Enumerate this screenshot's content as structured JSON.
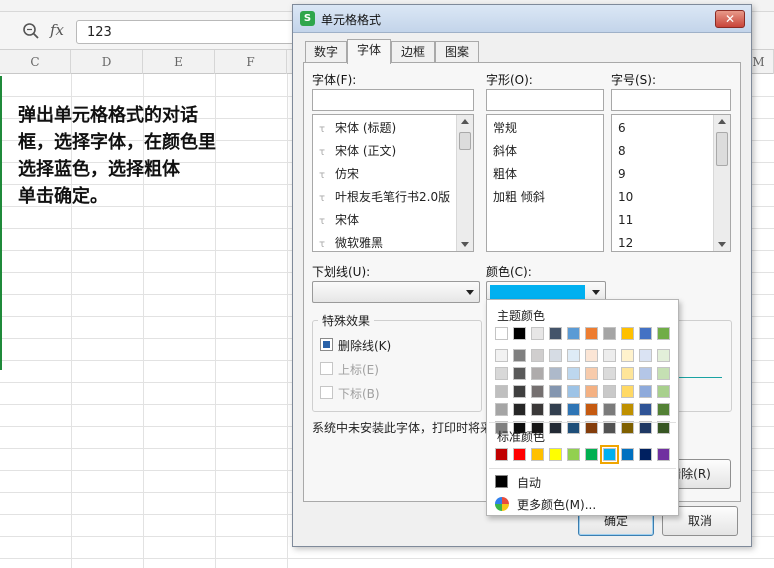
{
  "formula_bar": {
    "cell_value": "123"
  },
  "columns": [
    "C",
    "D",
    "E",
    "F",
    "M"
  ],
  "instruction_lines": [
    "弹出单元格格式的对话",
    "框，选择字体，在颜色里",
    "选择蓝色，选择粗体",
    "单击确定。"
  ],
  "dialog": {
    "title": "单元格格式",
    "tabs": [
      "数字",
      "字体",
      "边框",
      "图案"
    ],
    "active_tab": "字体",
    "font": {
      "label": "字体(F):",
      "items": [
        "宋体 (标题)",
        "宋体 (正文)",
        "仿宋",
        "叶根友毛笔行书2.0版",
        "宋体",
        "微软雅黑"
      ]
    },
    "style": {
      "label": "字形(O):",
      "items": [
        "常规",
        "斜体",
        "粗体",
        "加粗 倾斜"
      ]
    },
    "size": {
      "label": "字号(S):",
      "items": [
        "6",
        "8",
        "9",
        "10",
        "11",
        "12"
      ]
    },
    "underline": {
      "label": "下划线(U):"
    },
    "color": {
      "label": "颜色(C):",
      "value_color": "#00b0f0"
    },
    "effects": {
      "title": "特殊效果",
      "strikethrough": {
        "label": "删除线(K)",
        "checked": true
      },
      "superscript": {
        "label": "上标(E)",
        "enabled": false
      },
      "subscript": {
        "label": "下标(B)",
        "enabled": false
      }
    },
    "hint": "系统中未安装此字体，打印时将采",
    "clear_label": "清除(R)",
    "ok_label": "确定",
    "cancel_label": "取消"
  },
  "palette": {
    "theme_title": "主题颜色",
    "theme_top": [
      "#ffffff",
      "#000000",
      "#e7e6e6",
      "#44546a",
      "#5b9bd5",
      "#ed7d31",
      "#a5a5a5",
      "#ffc000",
      "#4472c4",
      "#70ad47"
    ],
    "theme_shades": [
      [
        "#f2f2f2",
        "#7f7f7f",
        "#d0cece",
        "#d6dce4",
        "#deebf6",
        "#fbe5d5",
        "#ededed",
        "#fff2cc",
        "#dae3f3",
        "#e2efd9"
      ],
      [
        "#d8d8d8",
        "#595959",
        "#aeabab",
        "#adb9ca",
        "#bdd7ee",
        "#f7cbac",
        "#dbdbdb",
        "#fee599",
        "#b4c6e7",
        "#c5e0b3"
      ],
      [
        "#bfbfbf",
        "#3f3f3f",
        "#757070",
        "#8496b0",
        "#9dc3e6",
        "#f4b183",
        "#c9c9c9",
        "#ffd965",
        "#8eaadb",
        "#a8d08d"
      ],
      [
        "#a5a5a5",
        "#262626",
        "#3a3838",
        "#323f4f",
        "#2e75b5",
        "#c55a11",
        "#7b7b7b",
        "#bf9000",
        "#2f5496",
        "#538135"
      ],
      [
        "#7f7f7f",
        "#0c0c0c",
        "#171616",
        "#222a35",
        "#1e4e79",
        "#833c0b",
        "#525252",
        "#7f6000",
        "#1f3864",
        "#375623"
      ]
    ],
    "standard_title": "标准颜色",
    "standard": [
      "#c00000",
      "#ff0000",
      "#ffc000",
      "#ffff00",
      "#92d050",
      "#00b050",
      "#00b0f0",
      "#0070c0",
      "#002060",
      "#7030a0"
    ],
    "selected_standard": 6,
    "auto_label": "自动",
    "more_label": "更多颜色(M)..."
  }
}
